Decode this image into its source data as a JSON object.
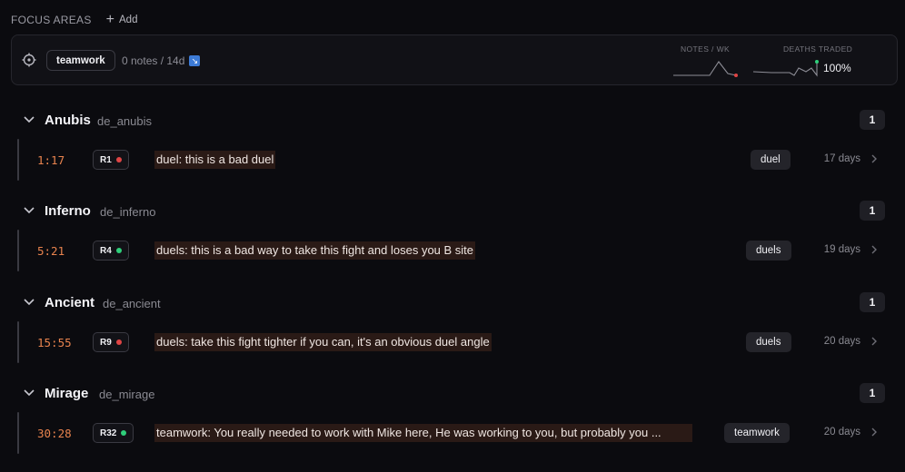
{
  "header": {
    "title": "FOCUS AREAS",
    "add_label": "Add"
  },
  "focus": {
    "tag": "teamwork",
    "notes_summary": "0 notes / 14d",
    "notes_per_week_label": "NOTES / WK",
    "deaths_traded_label": "DEATHS TRADED",
    "deaths_traded_value": "100%"
  },
  "colors": {
    "orange": "#e8834e",
    "red_dot": "#e04545",
    "green_dot": "#2fcf7a",
    "accent_blue": "#3d7bd6"
  },
  "groups": [
    {
      "map": "Anubis",
      "code": "de_anubis",
      "count": "1",
      "note": {
        "time": "1:17",
        "round": "R1",
        "status": "red",
        "text": "duel: this is a bad duel",
        "type": "duel",
        "age": "17 days"
      }
    },
    {
      "map": "Inferno",
      "code": "de_inferno",
      "count": "1",
      "note": {
        "time": "5:21",
        "round": "R4",
        "status": "green",
        "text": "duels: this is a bad way to take this fight and loses you B site",
        "type": "duels",
        "age": "19 days"
      }
    },
    {
      "map": "Ancient",
      "code": "de_ancient",
      "count": "1",
      "note": {
        "time": "15:55",
        "round": "R9",
        "status": "red",
        "text": "duels: take this fight tighter if you can, it's an obvious duel angle",
        "type": "duels",
        "age": "20 days"
      }
    },
    {
      "map": "Mirage",
      "code": "de_mirage",
      "count": "1",
      "note": {
        "time": "30:28",
        "round": "R32",
        "status": "green",
        "text": "teamwork: You really needed to work with Mike here, He was working to you, but probably you ...",
        "type": "teamwork",
        "age": "20 days"
      }
    }
  ]
}
